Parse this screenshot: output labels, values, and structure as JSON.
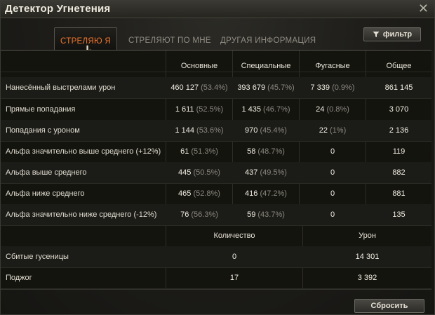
{
  "window": {
    "title": "Детектор Угнетения"
  },
  "tabs": [
    {
      "label": "СТРЕЛЯЮ Я"
    },
    {
      "label": "СТРЕЛЯЮТ ПО МНЕ"
    },
    {
      "label": "ДРУГАЯ ИНФОРМАЦИЯ"
    }
  ],
  "filter_button": {
    "label": "фильтр"
  },
  "damage_table": {
    "headers": [
      "Основные",
      "Специальные",
      "Фугасные",
      "Общее"
    ],
    "rows": [
      {
        "label": "Нанесённый выстрелами урон",
        "cells": [
          {
            "v": "460 127",
            "p": "(53.4%)"
          },
          {
            "v": "393 679",
            "p": "(45.7%)"
          },
          {
            "v": "7 339",
            "p": "(0.9%)"
          },
          {
            "v": "861 145",
            "p": ""
          }
        ]
      },
      {
        "label": "Прямые попадания",
        "cells": [
          {
            "v": "1 611",
            "p": "(52.5%)"
          },
          {
            "v": "1 435",
            "p": "(46.7%)"
          },
          {
            "v": "24",
            "p": "(0.8%)"
          },
          {
            "v": "3 070",
            "p": ""
          }
        ]
      },
      {
        "label": "Попадания с уроном",
        "cells": [
          {
            "v": "1 144",
            "p": "(53.6%)"
          },
          {
            "v": "970",
            "p": "(45.4%)"
          },
          {
            "v": "22",
            "p": "(1%)"
          },
          {
            "v": "2 136",
            "p": ""
          }
        ]
      },
      {
        "label": "Альфа значительно выше среднего (+12%)",
        "cells": [
          {
            "v": "61",
            "p": "(51.3%)"
          },
          {
            "v": "58",
            "p": "(48.7%)"
          },
          {
            "v": "0",
            "p": ""
          },
          {
            "v": "119",
            "p": ""
          }
        ]
      },
      {
        "label": "Альфа выше среднего",
        "cells": [
          {
            "v": "445",
            "p": "(50.5%)"
          },
          {
            "v": "437",
            "p": "(49.5%)"
          },
          {
            "v": "0",
            "p": ""
          },
          {
            "v": "882",
            "p": ""
          }
        ]
      },
      {
        "label": "Альфа ниже среднего",
        "cells": [
          {
            "v": "465",
            "p": "(52.8%)"
          },
          {
            "v": "416",
            "p": "(47.2%)"
          },
          {
            "v": "0",
            "p": ""
          },
          {
            "v": "881",
            "p": ""
          }
        ]
      },
      {
        "label": "Альфа значительно ниже среднего (-12%)",
        "cells": [
          {
            "v": "76",
            "p": "(56.3%)"
          },
          {
            "v": "59",
            "p": "(43.7%)"
          },
          {
            "v": "0",
            "p": ""
          },
          {
            "v": "135",
            "p": ""
          }
        ]
      }
    ]
  },
  "other_table": {
    "headers": [
      "Количество",
      "Урон"
    ],
    "rows": [
      {
        "label": "Сбитые гусеницы",
        "count": "0",
        "damage": "14 301"
      },
      {
        "label": "Поджог",
        "count": "17",
        "damage": "3 392"
      }
    ]
  },
  "reset_button": {
    "label": "Сбросить"
  },
  "icons": {
    "close": "close-icon",
    "filter": "funnel-icon",
    "cursor": "hand-cursor-icon"
  },
  "colors": {
    "active_tab": "#f0752e",
    "background": "#14140f"
  }
}
